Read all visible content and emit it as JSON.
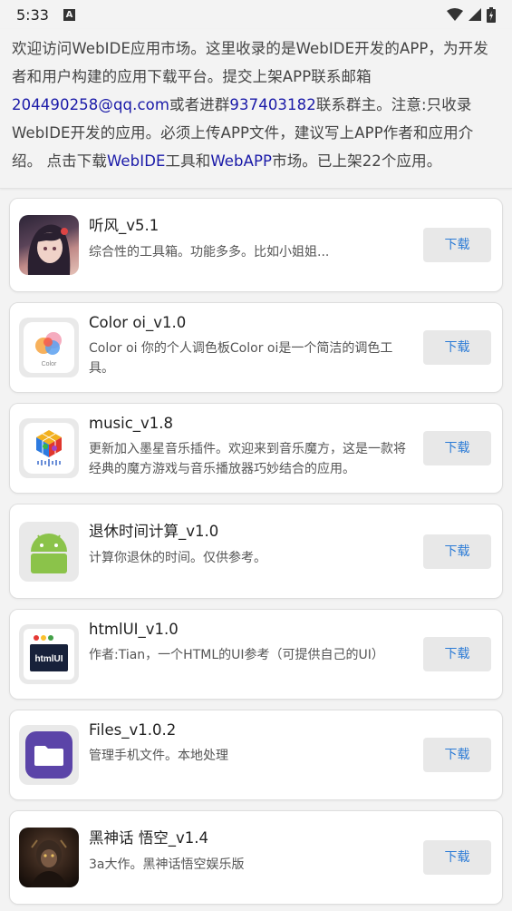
{
  "status_bar": {
    "time": "5:33"
  },
  "intro": {
    "t1": "欢迎访问WebIDE应用市场。这里收录的是WebIDE开发的APP，为开发者和用户构建的应用下载平台。提交上架APP联系邮箱",
    "email": "204490258@qq.com",
    "t2": "或者进群",
    "group": "937403182",
    "t3": "联系群主。注意:只收录WebIDE开发的应用。必须上传APP文件，建议写上APP作者和应用介绍。 点击下载",
    "webide": "WebIDE",
    "t4": "工具和",
    "webapp": "WebAPP",
    "t5": "市场。已上架22个应用。"
  },
  "apps": [
    {
      "title": "听风_v5.1",
      "desc": "综合性的工具箱。功能多多。比如小姐姐...",
      "button": "下载",
      "icon": "anime-girl-icon"
    },
    {
      "title": "Color oi_v1.0",
      "desc": "Color oi 你的个人调色板Color oi是一个简洁的调色工具。",
      "button": "下载",
      "icon": "color-palette-icon",
      "icon_text": "Color"
    },
    {
      "title": "music_v1.8",
      "desc": "更新加入墨星音乐插件。欢迎来到音乐魔方，这是一款将经典的魔方游戏与音乐播放器巧妙结合的应用。",
      "button": "下载",
      "icon": "rubiks-cube-icon"
    },
    {
      "title": "退休时间计算_v1.0",
      "desc": "计算你退休的时间。仅供参考。",
      "button": "下载",
      "icon": "android-icon"
    },
    {
      "title": "htmlUI_v1.0",
      "desc": "作者:Tian，一个HTML的UI参考（可提供自己的UI）",
      "button": "下载",
      "icon": "html-ui-icon",
      "icon_text": "htmlUI"
    },
    {
      "title": "Files_v1.0.2",
      "desc": "管理手机文件。本地处理",
      "button": "下载",
      "icon": "folder-icon"
    },
    {
      "title": "黑神话 悟空_v1.4",
      "desc": "3a大作。黑神话悟空娱乐版",
      "button": "下载",
      "icon": "wukong-icon"
    }
  ],
  "colors": {
    "link": "#1a1aa8",
    "download_text": "#2b7bd6",
    "files_purple": "#5b44a8"
  }
}
